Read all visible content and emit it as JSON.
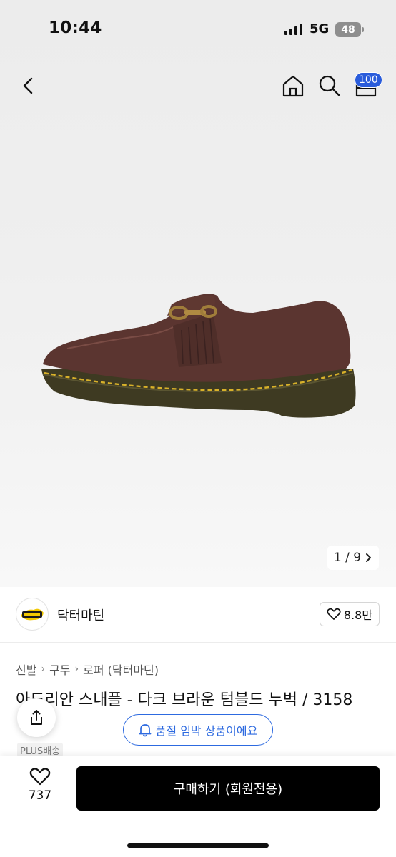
{
  "status_bar": {
    "time": "10:44",
    "network": "5G",
    "battery": "48"
  },
  "header": {
    "icons": [
      "back-icon",
      "home-icon",
      "search-icon",
      "cart-icon"
    ],
    "cart_badge": "100"
  },
  "gallery": {
    "counter": "1 / 9"
  },
  "brand": {
    "name": "닥터마틴",
    "likes": "8.8만",
    "logo_text": "Dr. Martens"
  },
  "breadcrumb": [
    "신발",
    "구두",
    "로퍼 (닥터마틴)"
  ],
  "product": {
    "title": "아드리안 스내플 - 다크 브라운 텀블드 누벅 / 3158",
    "delivery_badge": "PLUS배송"
  },
  "notice": {
    "soldout_text": "품절 임박 상품이에요"
  },
  "bottom_bar": {
    "wish_count": "737",
    "buy_label": "구매하기 (회원전용)"
  },
  "colors": {
    "accent_blue": "#2d6ae0",
    "badge_blue": "#2a5cdb",
    "buy_button": "#000000"
  }
}
